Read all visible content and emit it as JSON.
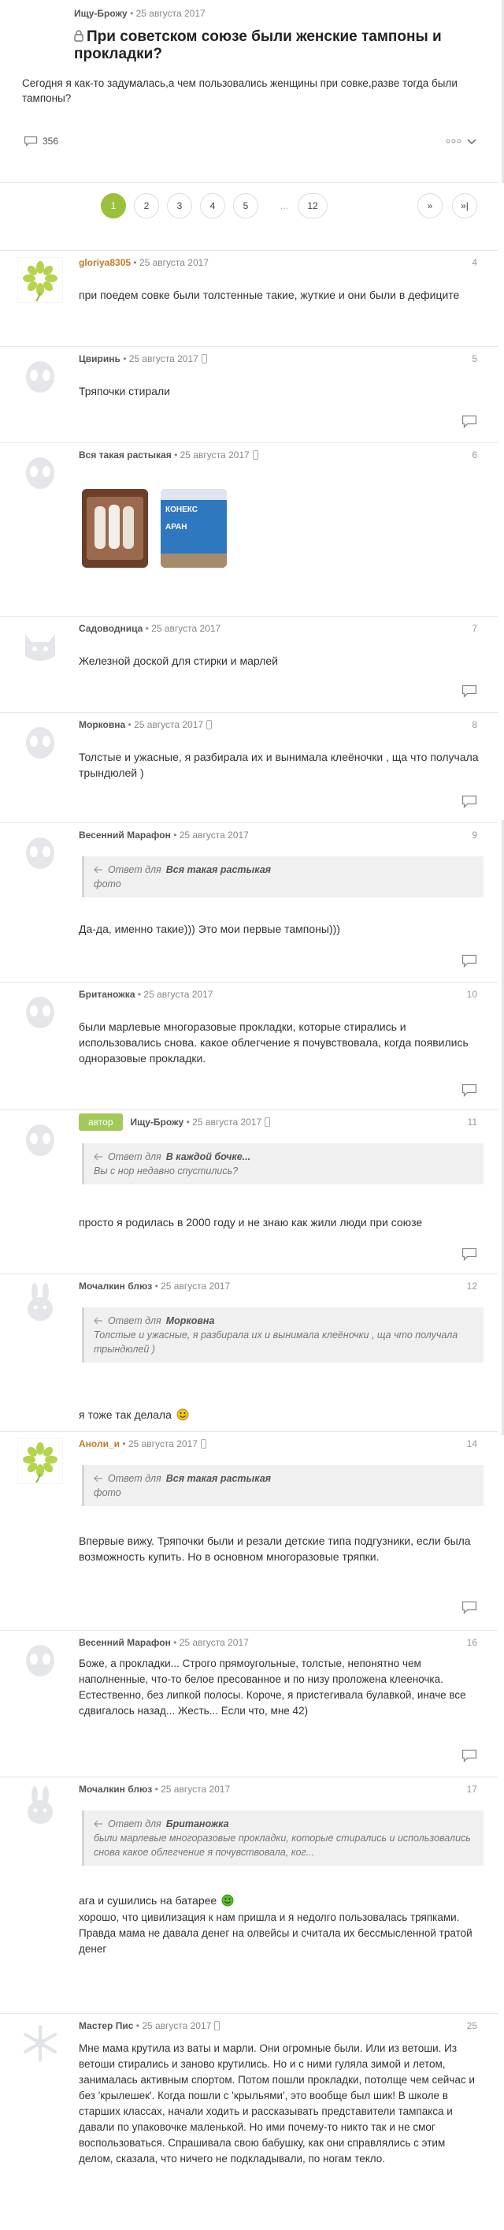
{
  "topic": {
    "author": "Ищу-Брожу",
    "date": "25 августа 2017",
    "title": "При советском союзе были женские тампоны и прокладки?",
    "body": "Сегодня я как-то задумалась,а чем пользовались женщины при совке,разве тогда были тампоны?",
    "comments_count": "356"
  },
  "pager": {
    "pages": [
      "1",
      "2",
      "3",
      "4",
      "5"
    ],
    "ellipsis": "...",
    "last": "12",
    "next": "»",
    "end": "»|"
  },
  "comments": [
    {
      "name": "gloriya8305",
      "date": "25 августа 2017",
      "num": "4",
      "text": "при поедем совке были толстенные такие, жуткие и они были в дефиците"
    },
    {
      "name": "Цвиринь",
      "date": "25 августа 2017",
      "num": "5",
      "text": "Тряпочки стирали"
    },
    {
      "name": "Вся такая растыкая",
      "date": "25 августа 2017",
      "num": "6",
      "photo2_text": "КОНЕКС\nАРАН"
    },
    {
      "name": "Садоводница",
      "date": "25 августа 2017",
      "num": "7",
      "text": "Железной доской для стирки и марлей"
    },
    {
      "name": "Морковна",
      "date": "25 августа 2017",
      "num": "8",
      "text": "Толстые и ужасные, я разбирала их и вынимала клеёночки , ща что получала трындюлей )"
    },
    {
      "name": "Весенний Марафон",
      "date": "25 августа 2017",
      "num": "9",
      "quote_prefix": "Ответ для",
      "quote_name": "Вся такая растыкая",
      "quote_text": "фото",
      "text": "Да-да, именно такие))) Это мои первые тампоны)))"
    },
    {
      "name": "Британожка",
      "date": "25 августа 2017",
      "num": "10",
      "text": "были марлевые многоразовые прокладки, которые стирались и использовались снова. какое облегчение я почувствовала, когда появились одноразовые прокладки."
    },
    {
      "badge": "автор",
      "name": "Ищу-Брожу",
      "date": "25 августа 2017",
      "num": "11",
      "quote_prefix": "Ответ для",
      "quote_name": "В каждой бочке...",
      "quote_text": "Вы с нор недавно спустились?",
      "text": "просто я родилась в 2000 году и не знаю как жили люди при союзе"
    },
    {
      "name": "Мочалкин блюз",
      "date": "25 августа 2017",
      "num": "12",
      "quote_prefix": "Ответ для",
      "quote_name": "Морковна",
      "quote_text": "Толстые и ужасные, я разбирала их и вынимала клеёночки , ща что получала трындюлей )",
      "text": "я тоже так делала"
    },
    {
      "name": "Аноли_и",
      "date": "25 августа 2017",
      "num": "14",
      "quote_prefix": "Ответ для",
      "quote_name": "Вся такая растыкая",
      "quote_text": "фото",
      "text": "Впервые вижу. Тряпочки были и резали детские типа подгузники, если была возможность купить. Но в основном многоразовые тряпки."
    },
    {
      "name": "Весенний Марафон",
      "date": "25 августа 2017",
      "num": "16",
      "text": "Боже, а прокладки... Строго прямоугольные, толстые, непонятно чем наполненные, что-то белое пресованное и по низу проложена клееночка. Естественно, без липкой полосы. Короче, я пристегивала булавкой, иначе все сдвигалось назад... Жесть... Если что, мне 42)"
    },
    {
      "name": "Мочалкин блюз",
      "date": "25 августа 2017",
      "num": "17",
      "quote_prefix": "Ответ для",
      "quote_name": "Британожка",
      "quote_text": "были марлевые многоразовые прокладки, которые стирались и использовались снова какое облегчение я почувствовала, ког...",
      "text": "ага и сушились на батарее",
      "text2": "хорошо, что цивилизация к нам пришла и я недолго пользовалась тряпками. Правда мама не давала денег на олвейсы и считала их бессмысленной тратой денег"
    },
    {
      "name": "Мастер Пис",
      "date": "25 августа 2017",
      "num": "25",
      "text": "Мне мама крутила из ваты и марли. Они огромные были. Или из ветоши. Из ветоши стирались и заново крутились. Но и с ними гуляла зимой и летом, занималась активным спортом. Потом пошли прокладки, потолще чем сейчас и без 'крылешек'. Когда пошли с 'крыльями', это вообще был шик! В школе в старших классах, начали ходить и рассказывать представители тампакса и давали по упаковочке маленькой. Но ими почему-то никто так и не смог воспользоваться. Спрашивала свою бабушку, как они справлялись с этим делом, сказала, что ничего не подкладывали, по ногам текло."
    }
  ],
  "colors": {
    "accent": "#9bc13c",
    "text": "#333333",
    "meta": "#888888",
    "quote_bg": "#f0f0f0"
  }
}
